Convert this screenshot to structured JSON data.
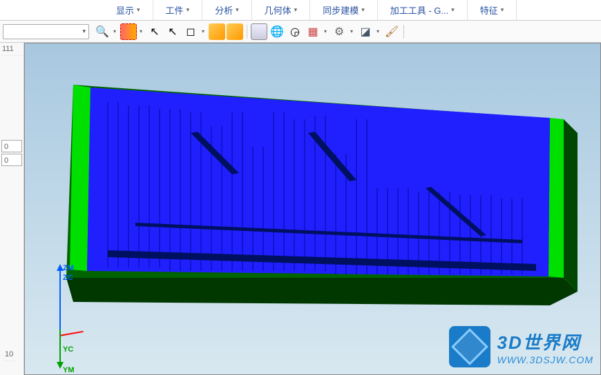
{
  "menu": {
    "items": [
      "显示",
      "工件",
      "分析",
      "几何体",
      "同步建模",
      "加工工具 - G...",
      "特征"
    ]
  },
  "toolbar": {
    "combo_value": ""
  },
  "left": {
    "top_label": "111",
    "box1": "0",
    "box2": "0",
    "bottom_label": "10"
  },
  "wcs": {
    "zm": "ZM",
    "zc": "ZC",
    "yc": "YC",
    "ym": "YM"
  },
  "watermark": {
    "title": "3D世界网",
    "url": "WWW.3DSJW.COM"
  },
  "icons": {
    "dropdown": "▾",
    "zoom": "🔍",
    "select": "⬚",
    "cursor": "↖",
    "box": "◻",
    "solid": "⬢",
    "view": "🌐",
    "grid": "▦",
    "circle": "◶",
    "palette": "▤",
    "gear": "⚙",
    "shape": "◪",
    "brush": "🖌"
  }
}
